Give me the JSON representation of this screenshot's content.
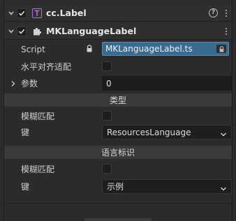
{
  "components": {
    "cc_label": {
      "title": "cc.Label",
      "enabled": true,
      "help": "?"
    },
    "mk_language_label": {
      "title": "MKLanguageLabel",
      "enabled": true
    }
  },
  "properties": {
    "script": {
      "label": "Script",
      "value": "MKLanguageLabel.ts"
    },
    "fit_alignment": {
      "label": "水平对齐适配",
      "checked": false
    },
    "params": {
      "label": "参数",
      "value": "0"
    }
  },
  "sections": {
    "type": {
      "title": "类型",
      "fuzzy_match_label": "模糊匹配",
      "fuzzy_match_checked": false,
      "key_label": "键",
      "key_value": "ResourcesLanguage"
    },
    "lang_id": {
      "title": "语言标识",
      "fuzzy_match_label": "模糊匹配",
      "fuzzy_match_checked": false,
      "key_label": "键",
      "key_value": "示例"
    }
  },
  "icons": {
    "collapse": "caret-down-icon",
    "expand": "caret-right-icon",
    "label_component": "label-component-icon",
    "script_component": "puzzle-piece-icon",
    "lock": "lock-icon",
    "menu": "kebab-menu-icon",
    "help": "help-icon",
    "dropdown": "chevron-down-icon"
  },
  "colors": {
    "background": "#2b2b2b",
    "label_icon": "#b073c9",
    "script_field": "#3a6a8e",
    "section_bar": "#3a3a3a"
  }
}
